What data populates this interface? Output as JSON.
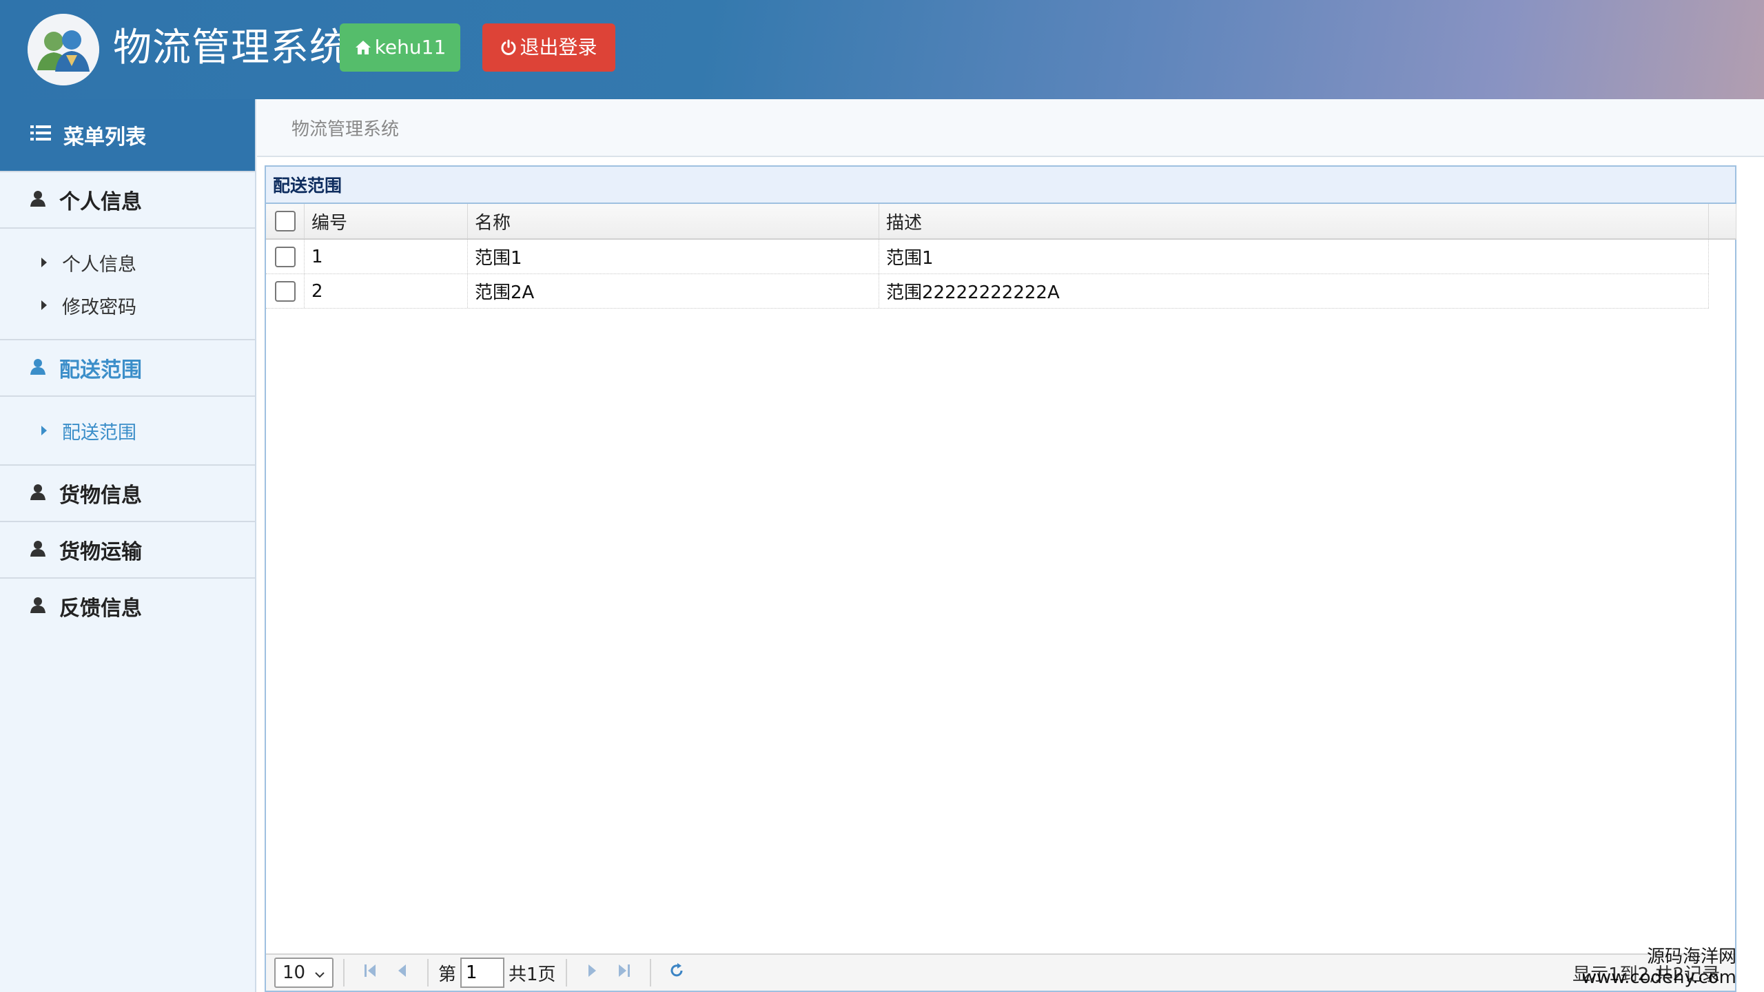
{
  "app": {
    "title": "物流管理系统",
    "user_label": "kehu11",
    "logout_label": "退出登录"
  },
  "sidebar": {
    "header": "菜单列表",
    "groups": [
      {
        "label": "个人信息",
        "items": [
          "个人信息",
          "修改密码"
        ]
      },
      {
        "label": "配送范围",
        "items": [
          "配送范围"
        ],
        "active": true
      },
      {
        "label": "货物信息"
      },
      {
        "label": "货物运输"
      },
      {
        "label": "反馈信息"
      }
    ]
  },
  "breadcrumb": "物流管理系统",
  "panel": {
    "title": "配送范围",
    "columns": [
      "编号",
      "名称",
      "描述"
    ],
    "rows": [
      {
        "id": "1",
        "name": "范围1",
        "desc": "范围1"
      },
      {
        "id": "2",
        "name": "范围2A",
        "desc": "范围22222222222A"
      }
    ]
  },
  "pager": {
    "page_size": "10",
    "page_prefix": "第",
    "page_value": "1",
    "page_total": "共1页",
    "info": "显示1到2,共2记录"
  },
  "watermark": {
    "line1": "源码海洋网",
    "line2": "www.codehy.com"
  },
  "colors": {
    "header_blue": "#2f74ac",
    "user_button": "#55bd6b",
    "logout_button": "#dd4337",
    "active_menu": "#3b8ec9"
  }
}
